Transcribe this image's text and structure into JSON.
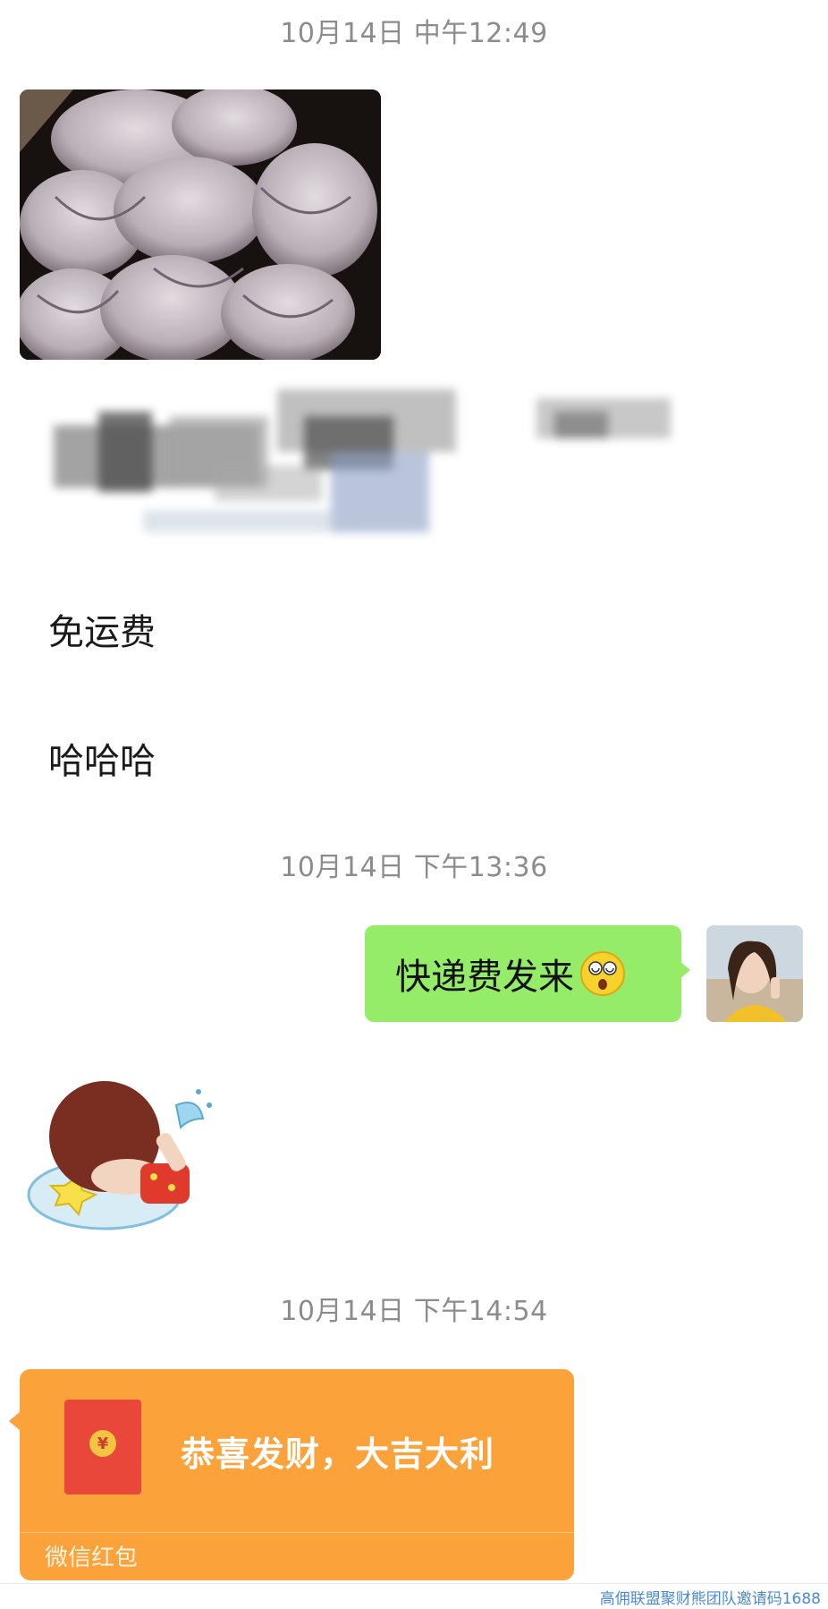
{
  "chat": {
    "timestamps": [
      "10月14日 中午12:49",
      "10月14日 下午13:36",
      "10月14日 下午14:54"
    ],
    "messages": {
      "free_shipping": "免运费",
      "laugh": "哈哈哈",
      "request": "快递费发来"
    },
    "red_packet": {
      "title": "恭喜发财，大吉大利",
      "label": "微信红包",
      "icon": "¥"
    }
  },
  "watermark": "高佣联盟聚财熊团队邀请码1688",
  "colors": {
    "sent_bubble": "#95ec69",
    "red_packet": "#fba23b",
    "timestamp": "#8c8c8c"
  },
  "icons": [
    "mushroom-photo",
    "dizzy-emoji",
    "user-avatar",
    "crying-sticker",
    "red-envelope-icon"
  ]
}
